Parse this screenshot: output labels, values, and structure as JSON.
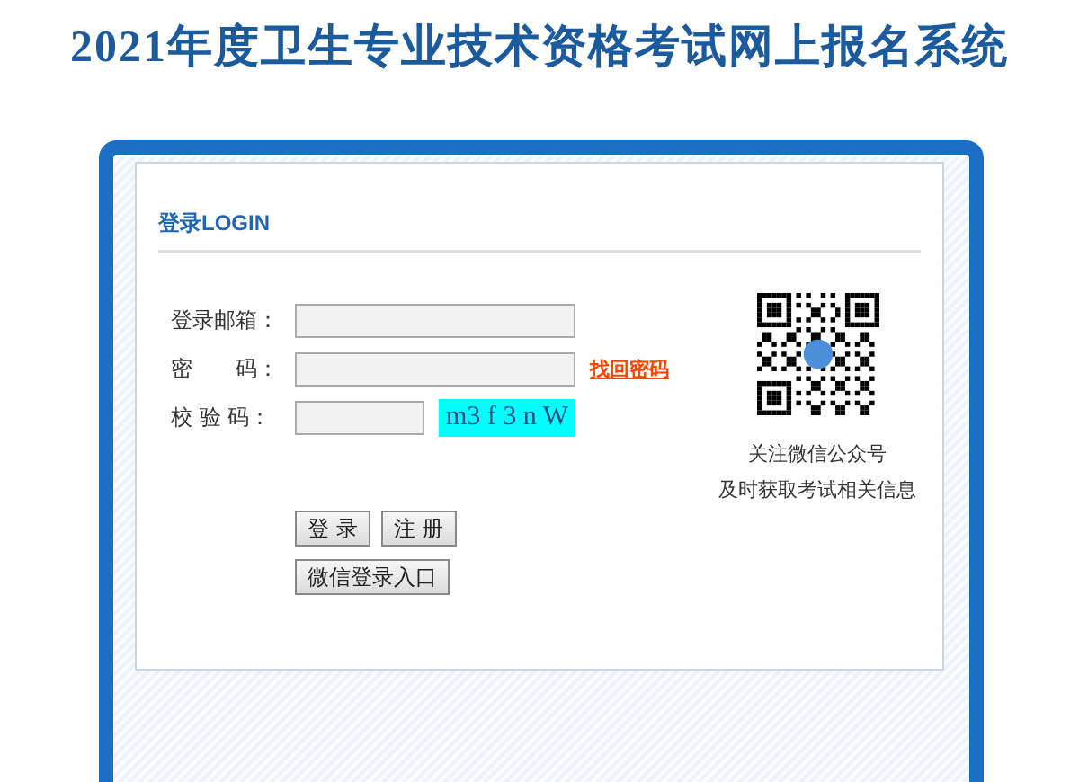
{
  "page_title": "2021年度卫生专业技术资格考试网上报名系统",
  "login": {
    "heading": "登录LOGIN",
    "fields": [
      {
        "label": "登录邮箱：",
        "kind": "text"
      },
      {
        "label": "密　　码：",
        "kind": "password",
        "link": "找回密码"
      },
      {
        "label": "校 验 码：",
        "kind": "captcha",
        "captcha": "m3 f 3 n W"
      }
    ],
    "buttons": [
      "登 录",
      "注 册"
    ],
    "wechat_button": "微信登录入口"
  },
  "qr": {
    "caption": [
      "关注微信公众号",
      "及时获取考试相关信息"
    ]
  }
}
